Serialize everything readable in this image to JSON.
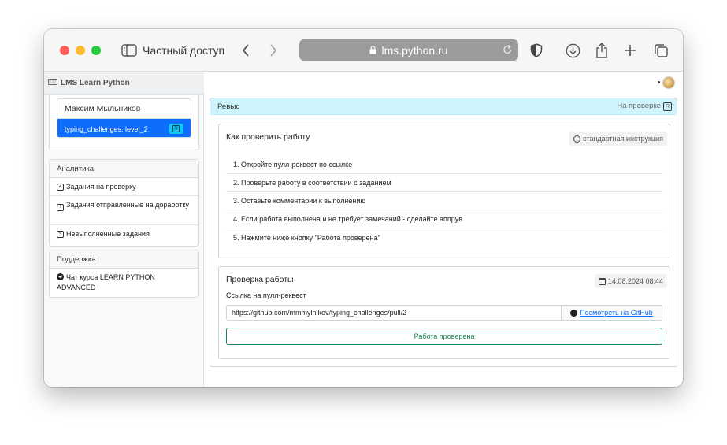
{
  "browser": {
    "private_label": "Частный доступ",
    "url": "lms.python.ru",
    "traffic_lights": [
      "#ff5f57",
      "#febc2e",
      "#28c840"
    ]
  },
  "sidebar": {
    "brand": "LMS Learn Python",
    "user_card": {
      "name": "Максим Мыльников",
      "active_item": "typing_challenges: level_2",
      "active_badge": "R"
    },
    "analytics": {
      "title": "Аналитика",
      "items": [
        {
          "icon": "checkbox-icon",
          "label": "Задания на проверку"
        },
        {
          "icon": "exclamation-icon",
          "label": "Задания отправленные на доработку"
        },
        {
          "icon": "pencil-icon",
          "label": "Невыполненные задания"
        }
      ]
    },
    "support": {
      "title": "Поддержка",
      "items": [
        {
          "icon": "telegram-icon",
          "label": "Чат курса LEARN PYTHON ADVANCED"
        }
      ]
    }
  },
  "review": {
    "title": "Ревью",
    "status": "На проверке",
    "status_badge": "R",
    "how_to": {
      "title": "Как проверить работу",
      "instruction_label": "стандартная инструкция",
      "steps": [
        "1. Откройте пулл-реквест по ссылке",
        "2. Проверьте работу в соответствии с заданием",
        "3. Оставьте комментарии к выполнению",
        "4. Если работа выполнена и не требует замечаний - сделайте аппрув",
        "5. Нажмите ниже кнопку \"Работа проверена\""
      ]
    },
    "check": {
      "title": "Проверка работы",
      "date": "14.08.2024 08:44",
      "link_label": "Ссылка на пулл-реквест",
      "link_value": "https://github.com/mmmylnikov/typing_challenges/pull/2",
      "github_label": "Посмотреть на GitHub",
      "done_button": "Работа проверена"
    }
  },
  "colors": {
    "accent": "#0d6efd",
    "review_header": "#cff4fc",
    "success": "#198754"
  }
}
